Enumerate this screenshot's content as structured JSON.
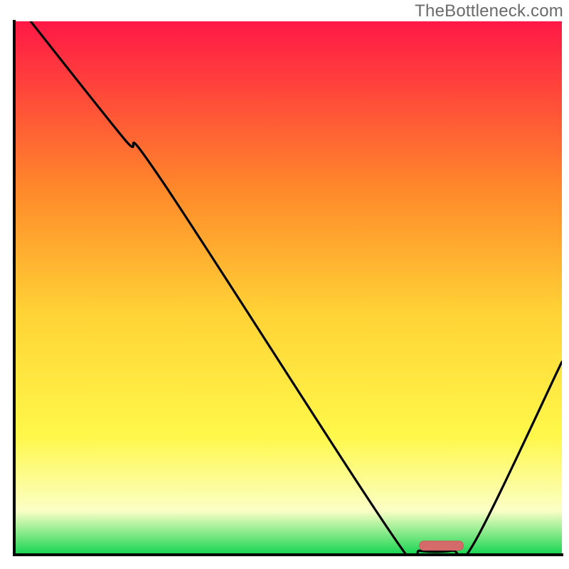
{
  "watermark": "TheBottleneck.com",
  "colors": {
    "gradient_top": "#ff1846",
    "gradient_mid_upper": "#ff8a2a",
    "gradient_mid": "#ffd335",
    "gradient_mid_lower": "#fff84a",
    "gradient_pale": "#fbffc6",
    "gradient_bottom": "#1cd653",
    "axis": "#000000",
    "curve": "#000000",
    "marker_fill": "#d46a6a",
    "marker_stroke": "#c85a5a"
  },
  "chart_data": {
    "type": "line",
    "title": "",
    "xlabel": "",
    "ylabel": "",
    "xlim": [
      0,
      100
    ],
    "ylim": [
      0,
      100
    ],
    "curve": [
      {
        "x": 3,
        "y": 100
      },
      {
        "x": 20,
        "y": 78
      },
      {
        "x": 27,
        "y": 70
      },
      {
        "x": 70,
        "y": 2
      },
      {
        "x": 74,
        "y": 0.5
      },
      {
        "x": 80,
        "y": 0.5
      },
      {
        "x": 84,
        "y": 2
      },
      {
        "x": 100,
        "y": 36
      }
    ],
    "marker": {
      "x_start": 74,
      "x_end": 82,
      "y": 1.5
    },
    "annotations": []
  }
}
